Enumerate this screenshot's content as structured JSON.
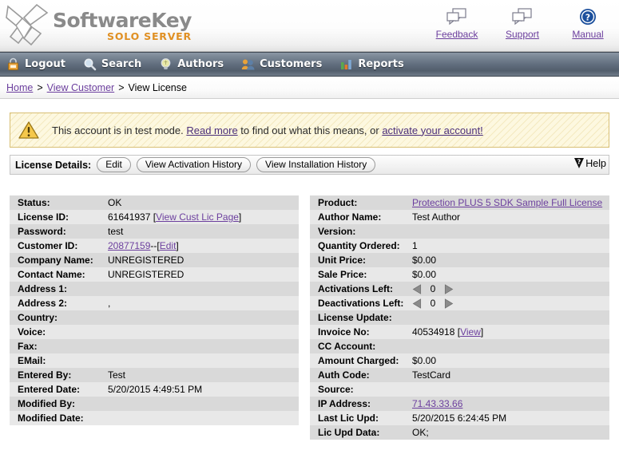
{
  "header": {
    "logo_name": "SoftwareKey",
    "logo_sub": "SOLO SERVER",
    "toplinks": [
      {
        "label": "Feedback",
        "icon": "speech-bubbles-icon"
      },
      {
        "label": "Support",
        "icon": "speech-bubbles-icon"
      },
      {
        "label": "Manual",
        "icon": "question-circle-icon"
      }
    ]
  },
  "nav": {
    "items": [
      {
        "label": "Logout",
        "icon": "padlock-icon"
      },
      {
        "label": "Search",
        "icon": "magnifier-icon"
      },
      {
        "label": "Authors",
        "icon": "lightbulb-icon"
      },
      {
        "label": "Customers",
        "icon": "users-icon"
      },
      {
        "label": "Reports",
        "icon": "bar-chart-icon"
      }
    ]
  },
  "breadcrumb": {
    "home": "Home",
    "sep": ">",
    "view_customer": "View Customer",
    "current": "View License"
  },
  "banner": {
    "icon": "warning-triangle-icon",
    "text_before": "This account is in test mode. ",
    "link1": "Read more",
    "text_middle": " to find out what this means, or ",
    "link2": "activate your account!",
    "text_after": ""
  },
  "toolbar": {
    "title": "License Details:",
    "buttons": [
      "Edit",
      "View Activation History",
      "View Installation History"
    ],
    "help_label": "Help",
    "help_icon": "help-flag-icon"
  },
  "left_panel": {
    "rows": [
      {
        "key": "Status:",
        "value": "OK"
      },
      {
        "key": "License ID:",
        "value": "61641937",
        "link_suffix": "View Cust Lic Page",
        "bracketed": true
      },
      {
        "key": "Password:",
        "value": "test"
      },
      {
        "key": "Customer ID:",
        "value": "20877159",
        "value_is_link": true,
        "dashes": " -- ",
        "link_suffix": "Edit",
        "bracketed": true
      },
      {
        "key": "Company Name:",
        "value": "UNREGISTERED"
      },
      {
        "key": "Contact Name:",
        "value": "UNREGISTERED"
      },
      {
        "key": "Address 1:",
        "value": ""
      },
      {
        "key": "Address 2:",
        "value": ","
      },
      {
        "key": "Country:",
        "value": ""
      },
      {
        "key": "Voice:",
        "value": ""
      },
      {
        "key": "Fax:",
        "value": ""
      },
      {
        "key": "EMail:",
        "value": ""
      },
      {
        "key": "Entered By:",
        "value": "Test"
      },
      {
        "key": "Entered Date:",
        "value": "5/20/2015 4:49:51 PM"
      },
      {
        "key": "Modified By:",
        "value": ""
      },
      {
        "key": "Modified Date:",
        "value": ""
      }
    ]
  },
  "right_panel": {
    "rows": [
      {
        "key": "Product:",
        "value": "Protection PLUS 5 SDK Sample Full License",
        "value_is_link": true
      },
      {
        "key": "Author Name:",
        "value": "Test Author"
      },
      {
        "key": "Version:",
        "value": ""
      },
      {
        "key": "Quantity Ordered:",
        "value": "1"
      },
      {
        "key": "Unit Price:",
        "value": "$0.00"
      },
      {
        "key": "Sale Price:",
        "value": "$0.00"
      },
      {
        "key": "Activations Left:",
        "value": "0",
        "stepper": true
      },
      {
        "key": "Deactivations Left:",
        "value": "0",
        "stepper": true
      },
      {
        "key": "License Update:",
        "value": ""
      },
      {
        "key": "Invoice No:",
        "value": "40534918",
        "link_suffix": "View",
        "bracketed": true
      },
      {
        "key": "CC Account:",
        "value": ""
      },
      {
        "key": "Amount Charged:",
        "value": "$0.00"
      },
      {
        "key": "Auth Code:",
        "value": "TestCard"
      },
      {
        "key": "Source:",
        "value": ""
      },
      {
        "key": "IP Address:",
        "value": "71.43.33.66",
        "value_is_link": true
      },
      {
        "key": "Last Lic Upd:",
        "value": "5/20/2015 6:24:45 PM"
      },
      {
        "key": "Lic Upd Data:",
        "value": "OK;"
      }
    ]
  },
  "colors": {
    "link": "#6c3f9e",
    "row_odd": "#d9d9d9",
    "row_even": "#e8e8e8",
    "banner_bg": "#fdf8e0",
    "banner_border": "#d8bf74",
    "logo_orange": "#e09023",
    "nav_bg": "#606d7d"
  }
}
